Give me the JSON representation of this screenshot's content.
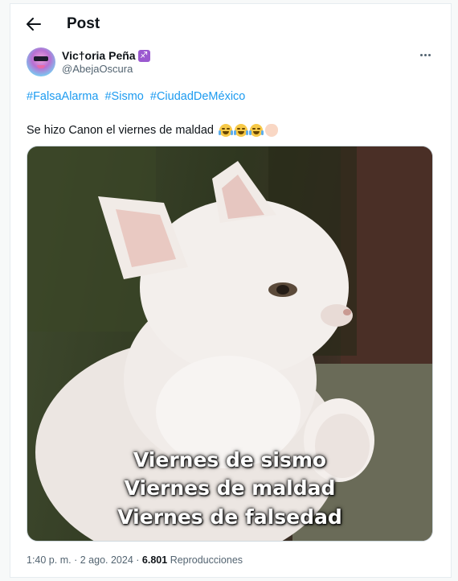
{
  "header": {
    "title": "Post",
    "back_icon": "arrow-left-icon"
  },
  "author": {
    "display_name": "Vic†oria Peña",
    "zodiac_badge": "♐",
    "handle": "@AbejaOscura",
    "more_icon": "more-horizontal-icon"
  },
  "tweet": {
    "hashtags": [
      "#FalsaAlarma",
      "#Sismo",
      "#CiudadDeMéxico"
    ],
    "text": "Se hizo Canon el viernes de maldad",
    "emojis": [
      "face-with-tears-of-joy",
      "face-with-tears-of-joy",
      "face-with-tears-of-joy",
      "pinched-fingers"
    ]
  },
  "media": {
    "image_subject": "white-cat-meme",
    "caption_lines": [
      "Viernes de sismo",
      "Viernes de maldad",
      "Viernes de falsedad"
    ]
  },
  "meta": {
    "time": "1:40 p. m.",
    "separator": "·",
    "date": "2 ago. 2024",
    "views_count": "6.801",
    "views_label": "Reproducciones"
  },
  "colors": {
    "link": "#1d9bf0",
    "secondary_text": "#536471",
    "primary_text": "#0f1419"
  }
}
